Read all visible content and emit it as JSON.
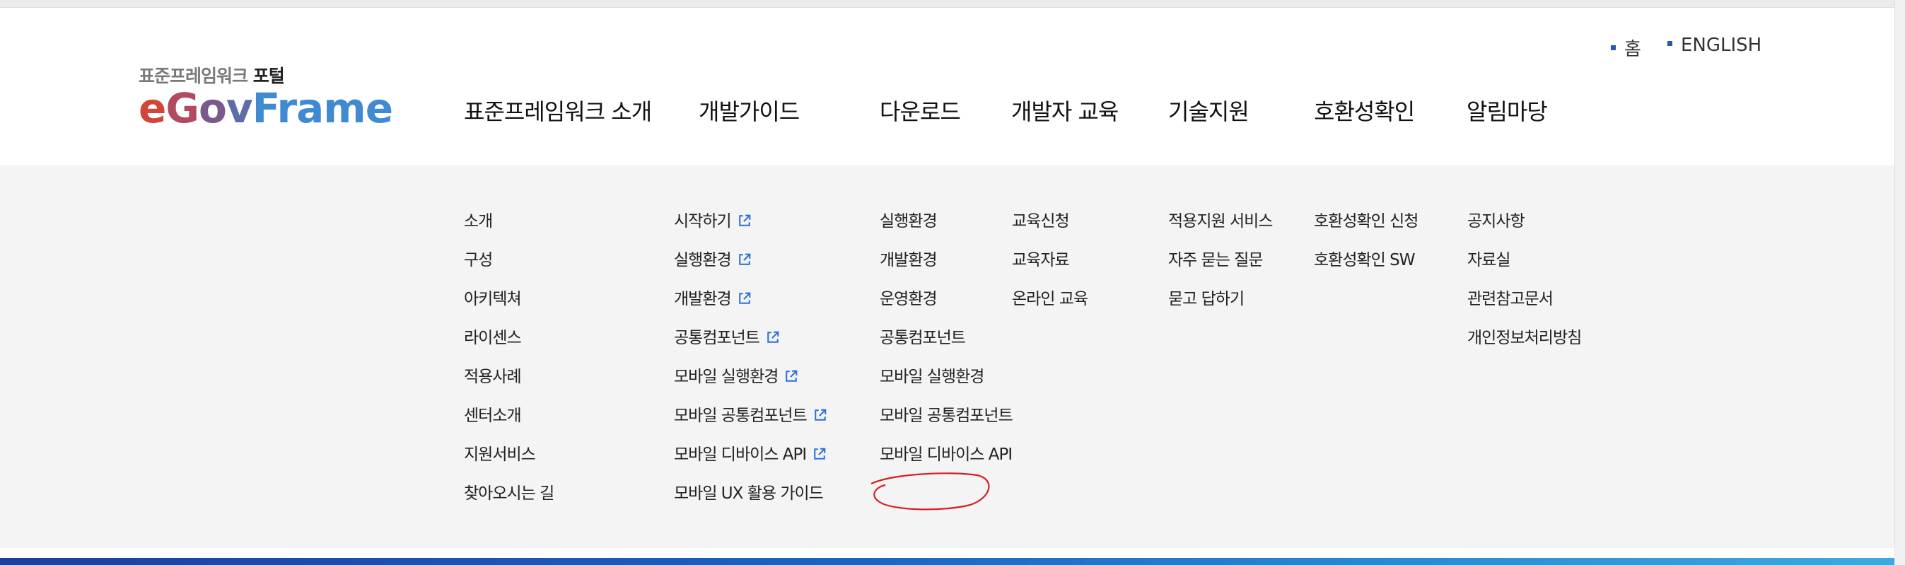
{
  "logo": {
    "sub_text": "표준프레임워크",
    "sub_bold": "포털",
    "main_text": "eGovFrame"
  },
  "util_links": {
    "home": "홈",
    "english": "ENGLISH"
  },
  "gnb": [
    "표준프레임워크 소개",
    "개발가이드",
    "다운로드",
    "개발자 교육",
    "기술지원",
    "호환성확인",
    "알림마당"
  ],
  "submenu": {
    "intro": [
      "소개",
      "구성",
      "아키텍쳐",
      "라이센스",
      "적용사례",
      "센터소개",
      "지원서비스",
      "찾아오시는 길"
    ],
    "guide": [
      "시작하기",
      "실행환경",
      "개발환경",
      "공통컴포넌트",
      "모바일 실행환경",
      "모바일 공통컴포넌트",
      "모바일 디바이스 API",
      "모바일 UX 활용 가이드"
    ],
    "download": [
      "실행환경",
      "개발환경",
      "운영환경",
      "공통컴포넌트",
      "모바일 실행환경",
      "모바일 공통컴포넌트",
      "모바일 디바이스 API"
    ],
    "education": [
      "교육신청",
      "교육자료",
      "온라인 교육"
    ],
    "support": [
      "적용지원 서비스",
      "자주 묻는 질문",
      "묻고 답하기"
    ],
    "compat": [
      "호환성확인 신청",
      "호환성확인 SW"
    ],
    "notice": [
      "공지사항",
      "자료실",
      "관련참고문서",
      "개인정보처리방침"
    ]
  },
  "colors": {
    "accent": "#2a56b8",
    "mega_bg": "#f4f4f4",
    "annotation": "#d62020"
  },
  "icons": {
    "external_link": "external-link-icon",
    "util_bullet": "square-bullet-icon"
  }
}
